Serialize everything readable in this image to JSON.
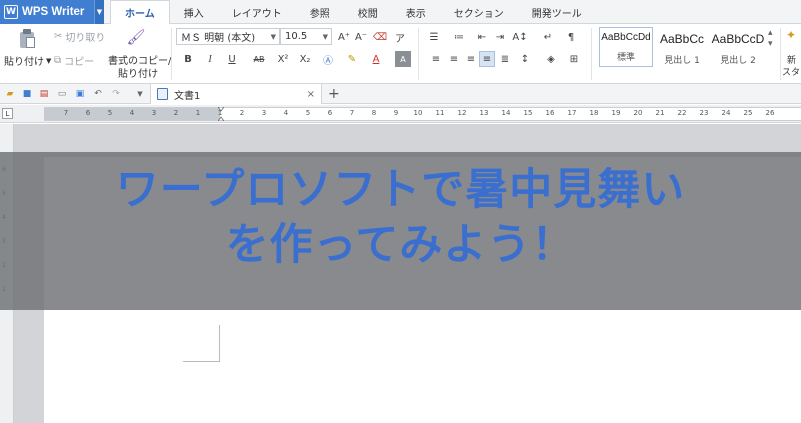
{
  "app": {
    "logo": "W",
    "name": "WPS Writer"
  },
  "menu_tabs": [
    "ホーム",
    "挿入",
    "レイアウト",
    "参照",
    "校閲",
    "表示",
    "セクション",
    "開発ツール"
  ],
  "clipboard": {
    "paste": "貼り付け",
    "cut": "切り取り",
    "copy": "コピー",
    "format_painter_line1": "書式のコピー/",
    "format_painter_line2": "貼り付け"
  },
  "font": {
    "name": "ＭＳ 明朝 (本文)",
    "size": "10.5"
  },
  "font_buttons": {
    "bold": "B",
    "italic": "I",
    "underline": "U",
    "strike": "AB",
    "super": "X²",
    "sub": "X₂",
    "grow": "A⁺",
    "shrink": "A⁻"
  },
  "styles": [
    {
      "sample": "AaBbCcDd",
      "label": "標準"
    },
    {
      "sample": "AaBbCc",
      "label": "見出し 1"
    },
    {
      "sample": "AaBbCcD",
      "label": "見出し 2"
    }
  ],
  "new_style": {
    "line1": "新",
    "line2": "スタイ"
  },
  "document_tab": {
    "title": "文書1",
    "close": "×",
    "new": "+"
  },
  "ruler_ticks": [
    "7",
    "6",
    "5",
    "4",
    "3",
    "2",
    "1",
    "1",
    "2",
    "3",
    "4",
    "5",
    "6",
    "7",
    "8",
    "9",
    "10",
    "11",
    "12",
    "13",
    "14",
    "15",
    "16",
    "17",
    "18",
    "19",
    "20",
    "21",
    "22",
    "23",
    "24",
    "25",
    "26"
  ],
  "vertical_ticks": [
    "6",
    "5",
    "4",
    "3",
    "2",
    "1"
  ],
  "banner": {
    "line1": "ワープロソフトで暑中見舞い",
    "line2": "を作ってみよう！"
  },
  "colors": {
    "accent": "#3f7ed0",
    "banner_text": "#3a6fd0",
    "overlay": "#6e7074"
  }
}
